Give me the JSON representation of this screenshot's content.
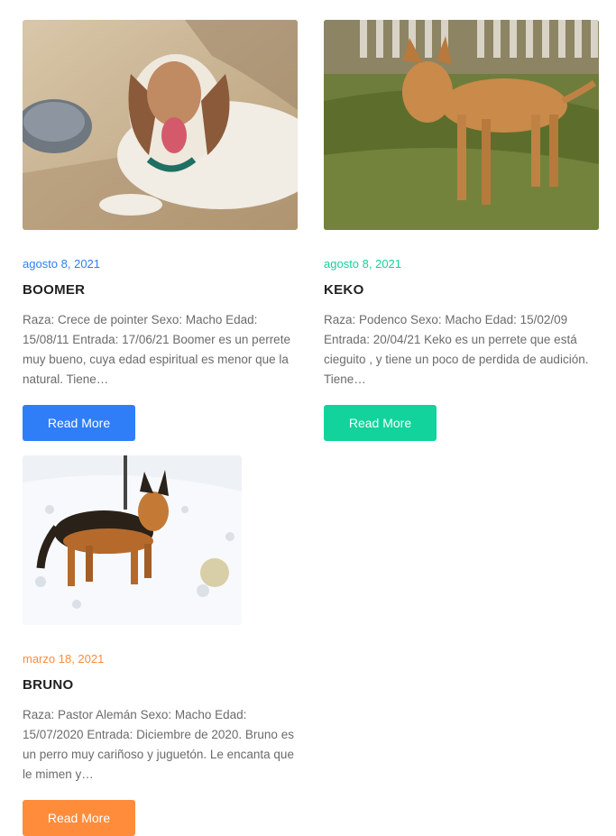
{
  "colors": {
    "blue": "#2f7ef7",
    "green": "#12d39b",
    "orange": "#ff8c3b"
  },
  "posts": [
    {
      "date": "agosto 8, 2021",
      "title": "BOOMER",
      "excerpt": "Raza: Crece de pointer Sexo: Macho Edad: 15/08/11 Entrada: 17/06/21 Boomer es un perrete muy bueno, cuya edad espiritual es menor que la natural. Tiene…",
      "button": "Read More",
      "image": "photo of a white and brown pointer dog lying on the ground"
    },
    {
      "date": "agosto 8, 2021",
      "title": "KEKO",
      "excerpt": "Raza: Podenco Sexo: Macho Edad: 15/02/09 Entrada: 20/04/21 Keko es un perrete que está cieguito , y tiene un poco de perdida de audición. Tiene…",
      "button": "Read More",
      "image": "photo of a tan podenco dog standing in grass by a fence"
    },
    {
      "date": "marzo 18, 2021",
      "title": "BRUNO",
      "excerpt": "Raza: Pastor Alemán Sexo: Macho Edad: 15/07/2020 Entrada: Diciembre de 2020. Bruno es un perro muy cariñoso y juguetón. Le encanta que le mimen y…",
      "button": "Read More",
      "image": "photo of a German shepherd standing in snow"
    }
  ]
}
